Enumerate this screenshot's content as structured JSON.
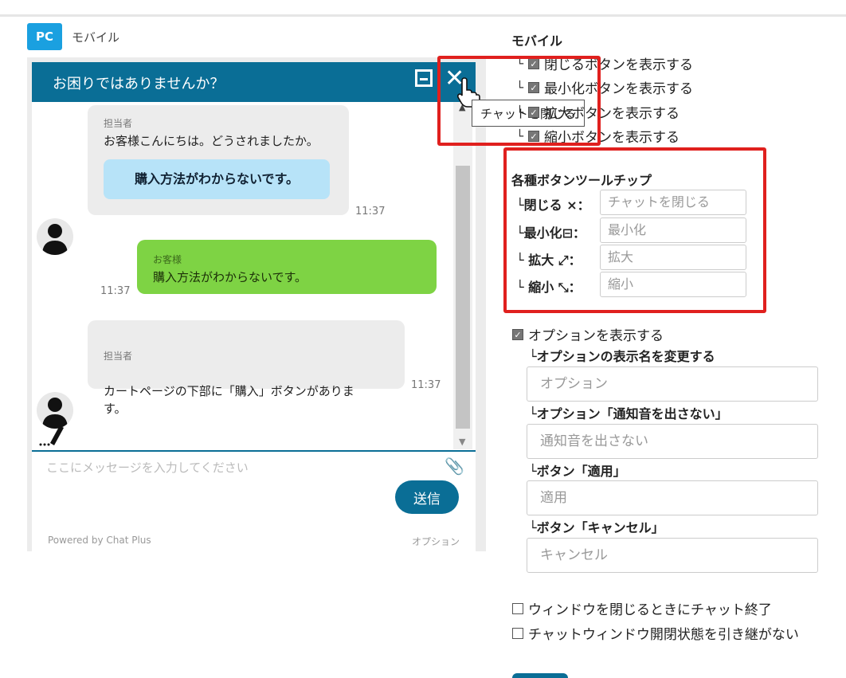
{
  "tabs": {
    "pc_badge": "PC",
    "mobile": "モバイル"
  },
  "chat": {
    "title": "お困りではありませんか？",
    "tooltip": "チャットを閉じる",
    "messages": [
      {
        "sender": "担当者",
        "text": "お客様こんにちは。どうされましたか。",
        "quick_reply": "購入方法がわからないです。",
        "time": "11:37"
      },
      {
        "sender": "お客様",
        "text": "購入方法がわからないです。",
        "time": "11:37"
      },
      {
        "sender": "担当者",
        "text": "カートページの下部に「購入」ボタンがありま\nす。",
        "time": "11:37"
      }
    ],
    "input_placeholder": "ここにメッセージを入力してください",
    "send_label": "送信",
    "powered_by": "Powered by Chat Plus",
    "option_link": "オプション"
  },
  "settings": {
    "mobile_title": "モバイル",
    "mobile_options": [
      {
        "label": "閉じるボタンを表示する",
        "checked": true
      },
      {
        "label": "最小化ボタンを表示する",
        "checked": true
      },
      {
        "label": "拡大ボタンを表示する",
        "checked": true
      },
      {
        "label": "縮小ボタンを表示する",
        "checked": true
      }
    ],
    "tooltip_title": "各種ボタンツールチップ",
    "tooltips": [
      {
        "label": "└閉じる ×：",
        "placeholder": "チャットを閉じる"
      },
      {
        "label": "└最小化⊟：",
        "placeholder": "最小化"
      },
      {
        "label": "└ 拡大 ⤢：",
        "placeholder": "拡大"
      },
      {
        "label": "└ 縮小 ⤡：",
        "placeholder": "縮小"
      }
    ],
    "show_option": {
      "label": "オプションを表示する",
      "checked": true
    },
    "option_fields": [
      {
        "label": "└オプションの表示名を変更する",
        "placeholder": "オプション"
      },
      {
        "label": "└オプション「通知音を出さない」",
        "placeholder": "通知音を出さない"
      },
      {
        "label": "└ボタン「適用」",
        "placeholder": "適用"
      },
      {
        "label": "└ボタン「キャンセル」",
        "placeholder": "キャンセル"
      }
    ],
    "end_on_close": {
      "label": "ウィンドウを閉じるときにチャット終了",
      "checked": false
    },
    "no_keep_state": {
      "label": "チャットウィンドウ開閉状態を引き継がない",
      "checked": false
    }
  },
  "colors": {
    "header": "#0a6e96",
    "customer_bubble": "#7ed344",
    "highlight": "#e0201e",
    "pc_badge": "#1aa0e0"
  }
}
